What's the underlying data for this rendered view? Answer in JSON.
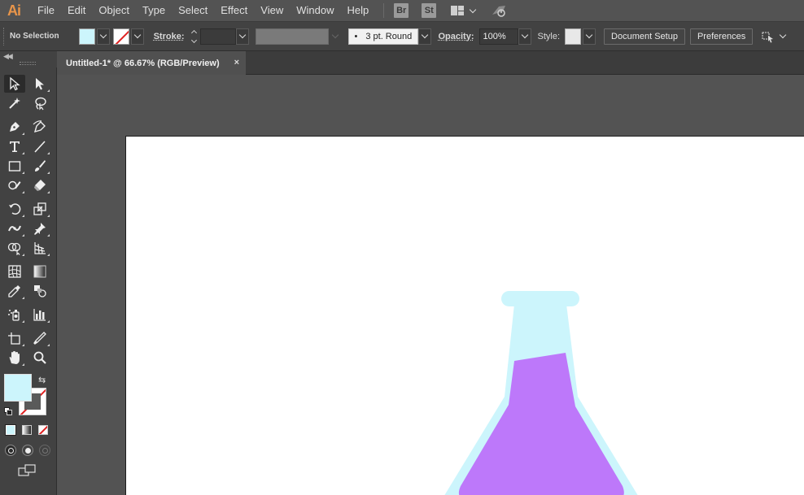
{
  "app": {
    "logo": "Ai"
  },
  "menu": [
    "File",
    "Edit",
    "Object",
    "Type",
    "Select",
    "Effect",
    "View",
    "Window",
    "Help"
  ],
  "app_badges": [
    "Br",
    "St"
  ],
  "control_bar": {
    "selection_label": "No Selection",
    "fill_color": "#ccf5fc",
    "stroke_label": "Stroke:",
    "stroke_weight": "",
    "brush_value": "3 pt. Round",
    "opacity_label": "Opacity:",
    "opacity_value": "100%",
    "style_label": "Style:",
    "document_setup": "Document Setup",
    "preferences": "Preferences"
  },
  "document_tab": {
    "title": "Untitled-1* @ 66.67% (RGB/Preview)",
    "close": "×"
  },
  "colors": {
    "flask_glass": "#ccf5fc",
    "flask_liquid": "#bd78fa",
    "artboard": "#ffffff",
    "canvas": "#535353"
  },
  "tools": [
    "selection-tool",
    "direct-selection-tool",
    "magic-wand-tool",
    "lasso-tool",
    "pen-tool",
    "curvature-tool",
    "type-tool",
    "line-segment-tool",
    "rectangle-tool",
    "paintbrush-tool",
    "shaper-tool",
    "eraser-tool",
    "rotate-tool",
    "scale-tool",
    "width-tool",
    "puppet-warp-tool",
    "shape-builder-tool",
    "perspective-grid-tool",
    "mesh-tool",
    "gradient-tool",
    "eyedropper-tool",
    "blend-tool",
    "symbol-sprayer-tool",
    "column-graph-tool",
    "artboard-tool",
    "slice-tool",
    "hand-tool",
    "zoom-tool"
  ]
}
